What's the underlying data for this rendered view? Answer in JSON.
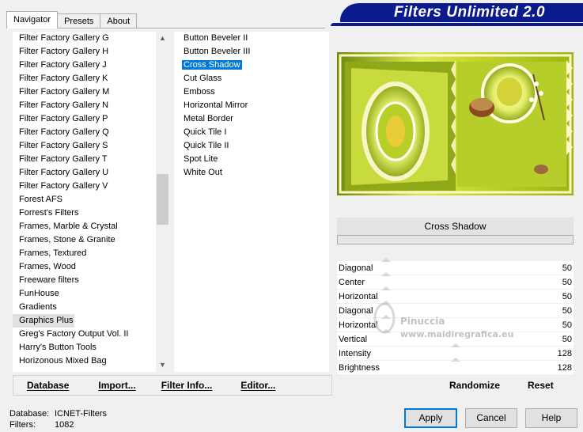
{
  "banner_title": "Filters Unlimited 2.0",
  "tabs": [
    {
      "label": "Navigator",
      "active": true
    },
    {
      "label": "Presets",
      "active": false
    },
    {
      "label": "About",
      "active": false
    }
  ],
  "categories": [
    "Filter Factory Gallery G",
    "Filter Factory Gallery H",
    "Filter Factory Gallery J",
    "Filter Factory Gallery K",
    "Filter Factory Gallery M",
    "Filter Factory Gallery N",
    "Filter Factory Gallery P",
    "Filter Factory Gallery Q",
    "Filter Factory Gallery S",
    "Filter Factory Gallery T",
    "Filter Factory Gallery U",
    "Filter Factory Gallery V",
    "Forest AFS",
    "Forrest's Filters",
    "Frames, Marble & Crystal",
    "Frames, Stone & Granite",
    "Frames, Textured",
    "Frames, Wood",
    "Freeware filters",
    "FunHouse",
    "Gradients",
    "Graphics Plus",
    "Greg's Factory Output Vol. II",
    "Harry's Button Tools",
    "Horizonous Mixed Bag"
  ],
  "selected_category": "Graphics Plus",
  "filters": [
    "Button Beveler II",
    "Button Beveler III",
    "Cross Shadow",
    "Cut Glass",
    "Emboss",
    "Horizontal Mirror",
    "Metal Border",
    "Quick Tile I",
    "Quick Tile II",
    "Spot Lite",
    "White Out"
  ],
  "selected_filter": "Cross Shadow",
  "bottom_buttons": {
    "database": "Database",
    "import": "Import...",
    "filter_info": "Filter Info...",
    "editor": "Editor..."
  },
  "current_filter_name": "Cross Shadow",
  "parameters": [
    {
      "name": "Diagonal",
      "value": "50"
    },
    {
      "name": "Center",
      "value": "50"
    },
    {
      "name": "Horizontal",
      "value": "50"
    },
    {
      "name": "Diagonal",
      "value": "50"
    },
    {
      "name": "Horizontal",
      "value": "50"
    },
    {
      "name": "Vertical",
      "value": "50"
    },
    {
      "name": "Intensity",
      "value": "128"
    },
    {
      "name": "Brightness",
      "value": "128"
    }
  ],
  "randomize_label": "Randomize",
  "reset_label": "Reset",
  "watermark": {
    "name": "Pinuccia",
    "url": "www.maidiregrafica.eu"
  },
  "status": {
    "database_label": "Database:",
    "database_value": "ICNET-Filters",
    "filters_label": "Filters:",
    "filters_value": "1082"
  },
  "dialog_buttons": {
    "apply": "Apply",
    "cancel": "Cancel",
    "help": "Help"
  },
  "colors": {
    "accent": "#0078d7",
    "banner": "#0b1a8c"
  }
}
